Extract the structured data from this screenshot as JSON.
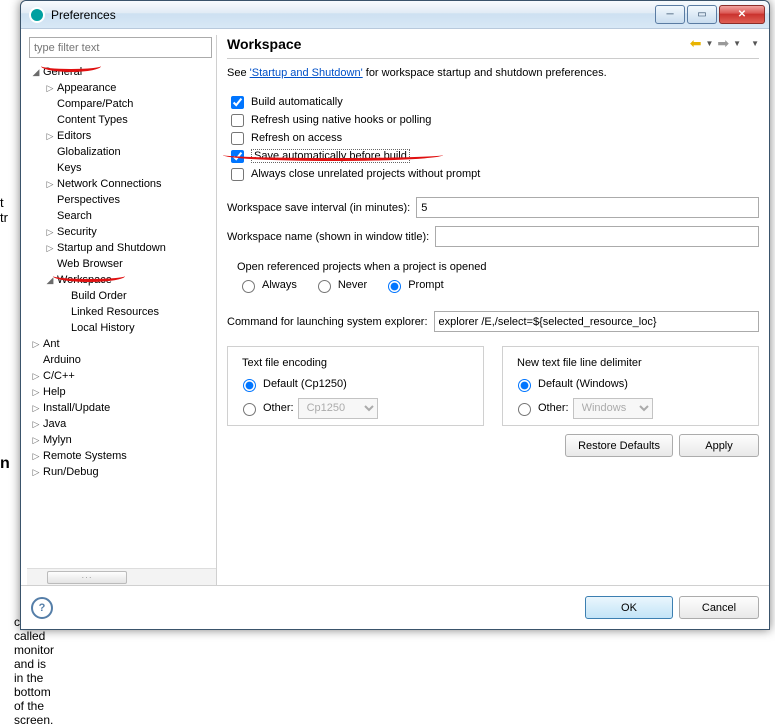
{
  "window_title": "Preferences",
  "filter_placeholder": "type filter text",
  "tree": {
    "general": "General",
    "appearance": "Appearance",
    "compare": "Compare/Patch",
    "content_types": "Content Types",
    "editors": "Editors",
    "globalization": "Globalization",
    "keys": "Keys",
    "network": "Network Connections",
    "perspectives": "Perspectives",
    "search": "Search",
    "security": "Security",
    "startup": "Startup and Shutdown",
    "web_browser": "Web Browser",
    "workspace": "Workspace",
    "build_order": "Build Order",
    "linked_resources": "Linked Resources",
    "local_history": "Local History",
    "ant": "Ant",
    "arduino": "Arduino",
    "cpp": "C/C++",
    "help": "Help",
    "install": "Install/Update",
    "java": "Java",
    "mylyn": "Mylyn",
    "remote": "Remote Systems",
    "run": "Run/Debug"
  },
  "page": {
    "title": "Workspace",
    "desc_prefix": "See ",
    "desc_link": "'Startup and Shutdown'",
    "desc_suffix": " for workspace startup and shutdown preferences.",
    "checks": {
      "build_auto": "Build automatically",
      "refresh_hooks": "Refresh using native hooks or polling",
      "refresh_access": "Refresh on access",
      "save_before_build": "Save automatically before build",
      "close_unrelated": "Always close unrelated projects without prompt"
    },
    "interval_label": "Workspace save interval (in minutes):",
    "interval_value": "5",
    "wsname_label": "Workspace name (shown in window title):",
    "wsname_value": "",
    "openref_label": "Open referenced projects when a project is opened",
    "radio_always": "Always",
    "radio_never": "Never",
    "radio_prompt": "Prompt",
    "explorer_label": "Command for launching system explorer:",
    "explorer_value": "explorer /E,/select=${selected_resource_loc}",
    "encoding_title": "Text file encoding",
    "encoding_default": "Default (Cp1250)",
    "encoding_other": "Other:",
    "encoding_other_value": "Cp1250",
    "delim_title": "New text file line delimiter",
    "delim_default": "Default (Windows)",
    "delim_other": "Other:",
    "delim_other_value": "Windows",
    "restore_defaults": "Restore Defaults",
    "apply": "Apply",
    "ok": "OK",
    "cancel": "Cancel"
  },
  "bg_text1": "ck is called monitor and is in the bottom of the screen."
}
